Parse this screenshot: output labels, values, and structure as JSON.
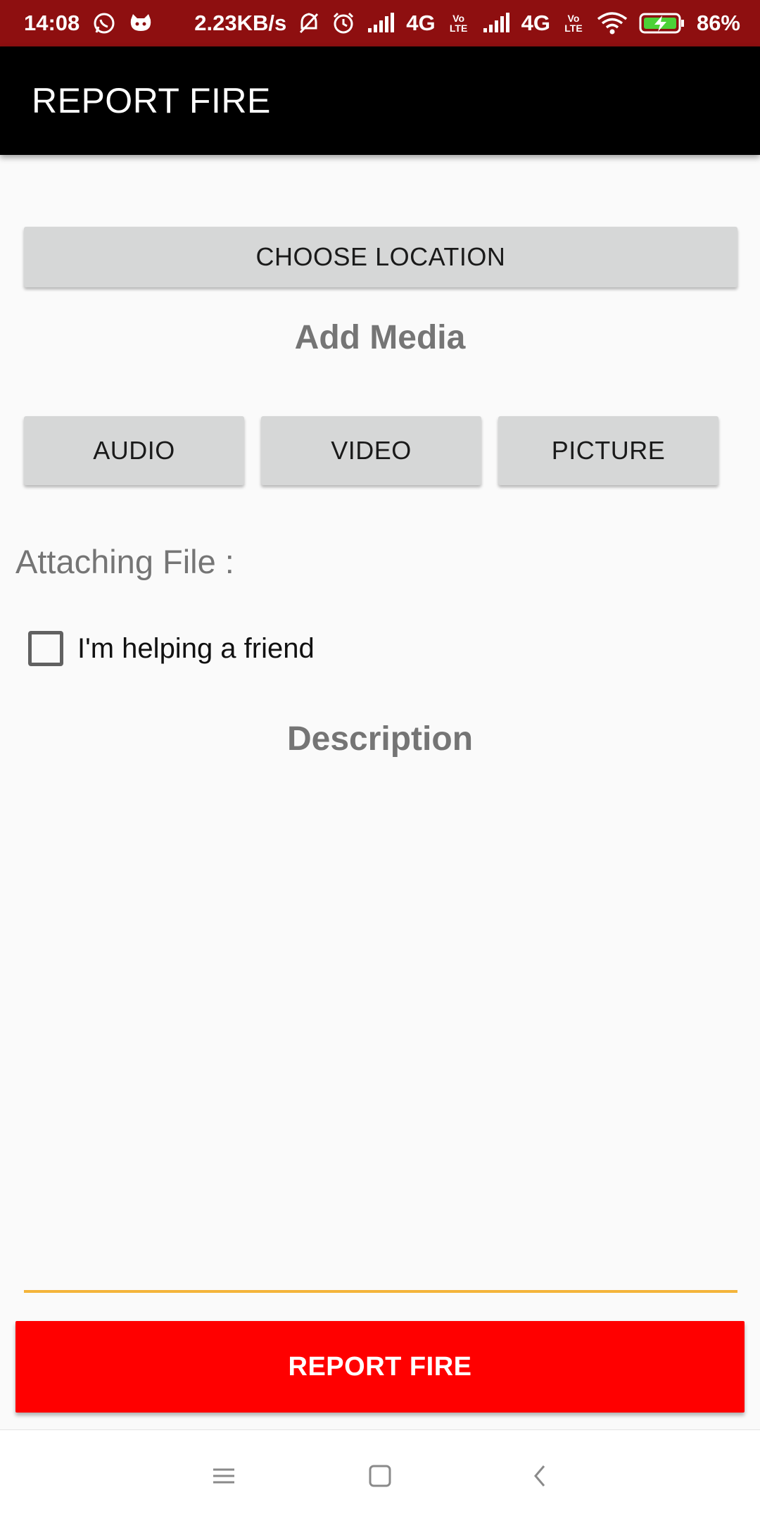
{
  "status_bar": {
    "time": "14:08",
    "net_speed": "2.23KB/s",
    "network1": "4G",
    "network2": "4G",
    "volte1": "Vo LTE",
    "volte2": "Vo LTE",
    "battery": "86%",
    "icons": [
      "whatsapp-icon",
      "cat-icon",
      "mute-icon",
      "alarm-icon",
      "signal-icon",
      "signal-icon",
      "wifi-icon",
      "battery-charging-icon"
    ],
    "bg_color": "#8e0f10"
  },
  "app_bar": {
    "title": "REPORT FIRE",
    "bg_color": "#000000"
  },
  "main": {
    "choose_location_label": "CHOOSE LOCATION",
    "add_media_title": "Add Media",
    "media_buttons": [
      {
        "label": "AUDIO"
      },
      {
        "label": "VIDEO"
      },
      {
        "label": "PICTURE"
      }
    ],
    "attaching_file_label": "Attaching File :",
    "helping_friend": {
      "label": "I'm helping a friend",
      "checked": false
    },
    "description_title": "Description",
    "description_value": "",
    "field_underline_color": "#f4b43a",
    "report_button_label": "REPORT FIRE",
    "report_button_color": "#ff0000"
  },
  "nav_bar": {
    "icons": [
      "menu-icon",
      "home-square-icon",
      "back-chevron-icon"
    ]
  }
}
